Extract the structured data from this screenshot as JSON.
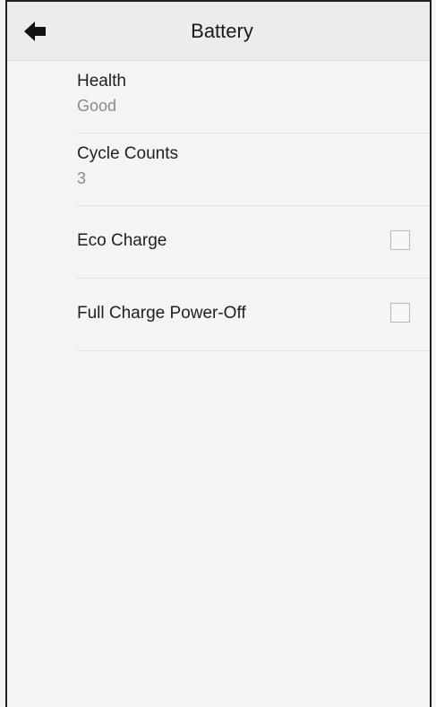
{
  "header": {
    "title": "Battery"
  },
  "icons": {
    "back": "back-arrow-icon"
  },
  "items": [
    {
      "label": "Health",
      "value": "Good"
    },
    {
      "label": "Cycle Counts",
      "value": "3"
    }
  ],
  "toggles": [
    {
      "label": "Eco Charge",
      "checked": false
    },
    {
      "label": "Full Charge Power-Off",
      "checked": false
    }
  ]
}
